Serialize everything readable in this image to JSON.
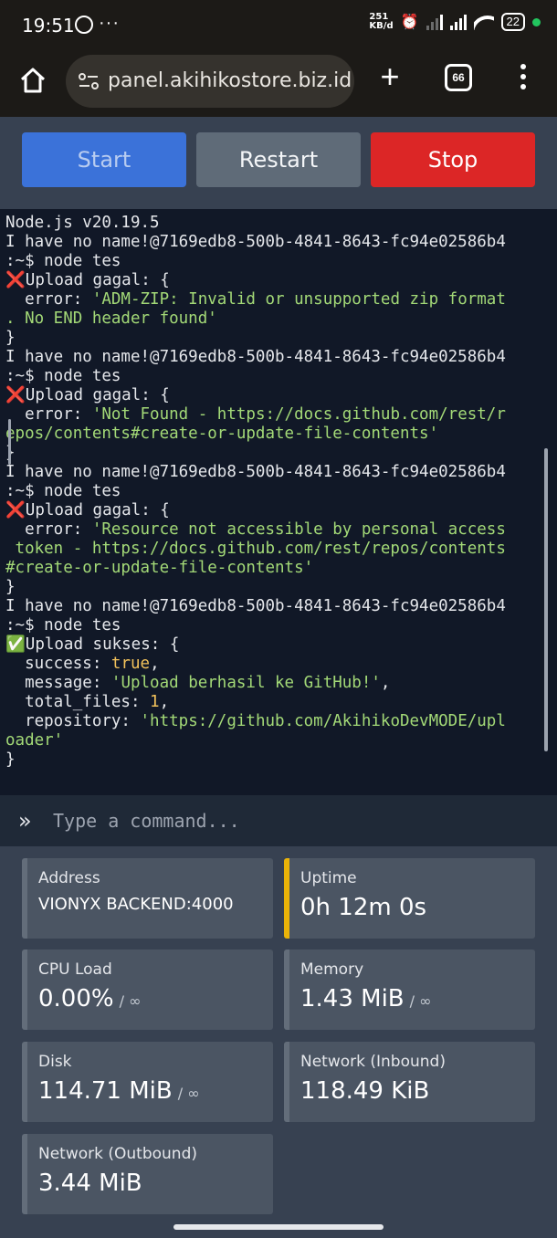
{
  "status_bar": {
    "time": "19:51",
    "more": "···",
    "net_speed_top": "251",
    "net_speed_bottom": "KB/d",
    "battery": "22"
  },
  "browser": {
    "url": "panel.akihikostore.biz.id",
    "tab_count": "66"
  },
  "actions": {
    "start_label": "Start",
    "restart_label": "Restart",
    "stop_label": "Stop"
  },
  "console": {
    "lines": [
      [
        {
          "t": "Node.js v20.19.5"
        }
      ],
      [
        {
          "t": "I have no name!@7169edb8-500b-4841-8643-fc94e02586b4"
        }
      ],
      [
        {
          "t": ":~$ node tes"
        }
      ],
      [
        {
          "t": "❌Upload gagal: {"
        }
      ],
      [
        {
          "t": "  error: "
        },
        {
          "t": "'ADM-ZIP: Invalid or unsupported zip format",
          "c": "str"
        }
      ],
      [
        {
          "t": ". No END header found'",
          "c": "str"
        }
      ],
      [
        {
          "t": "}"
        }
      ],
      [
        {
          "t": "I have no name!@7169edb8-500b-4841-8643-fc94e02586b4"
        }
      ],
      [
        {
          "t": ":~$ node tes"
        }
      ],
      [
        {
          "t": "❌Upload gagal: {"
        }
      ],
      [
        {
          "t": "  error: "
        },
        {
          "t": "'Not Found - https://docs.github.com/rest/r",
          "c": "str"
        }
      ],
      [
        {
          "t": "epos/contents#create-or-update-file-contents'",
          "c": "str"
        }
      ],
      [
        {
          "t": "}"
        }
      ],
      [
        {
          "t": "I have no name!@7169edb8-500b-4841-8643-fc94e02586b4"
        }
      ],
      [
        {
          "t": ":~$ node tes"
        }
      ],
      [
        {
          "t": "❌Upload gagal: {"
        }
      ],
      [
        {
          "t": "  error: "
        },
        {
          "t": "'Resource not accessible by personal access",
          "c": "str"
        }
      ],
      [
        {
          "t": " token - https://docs.github.com/rest/repos/contents",
          "c": "str"
        }
      ],
      [
        {
          "t": "#create-or-update-file-contents'",
          "c": "str"
        }
      ],
      [
        {
          "t": "}"
        }
      ],
      [
        {
          "t": "I have no name!@7169edb8-500b-4841-8643-fc94e02586b4"
        }
      ],
      [
        {
          "t": ":~$ node tes"
        }
      ],
      [
        {
          "t": "✅Upload sukses: {"
        }
      ],
      [
        {
          "t": "  success: "
        },
        {
          "t": "true",
          "c": "kw"
        },
        {
          "t": ","
        }
      ],
      [
        {
          "t": "  message: "
        },
        {
          "t": "'Upload berhasil ke GitHub!'",
          "c": "str"
        },
        {
          "t": ","
        }
      ],
      [
        {
          "t": "  total_files: "
        },
        {
          "t": "1",
          "c": "kw"
        },
        {
          "t": ","
        }
      ],
      [
        {
          "t": "  repository: "
        },
        {
          "t": "'https://github.com/AkihikoDevMODE/upl",
          "c": "str"
        }
      ],
      [
        {
          "t": "oader'",
          "c": "str"
        }
      ],
      [
        {
          "t": "}"
        }
      ]
    ]
  },
  "command": {
    "placeholder": "Type a command..."
  },
  "stats": {
    "address": {
      "label": "Address",
      "value": "VIONYX BACKEND:4000"
    },
    "uptime": {
      "label": "Uptime",
      "value": "0h 12m 0s"
    },
    "cpu": {
      "label": "CPU Load",
      "value": "0.00%",
      "limit": "/ ∞"
    },
    "memory": {
      "label": "Memory",
      "value": "1.43 MiB",
      "limit": "/ ∞"
    },
    "disk": {
      "label": "Disk",
      "value": "114.71 MiB",
      "limit": "/ ∞"
    },
    "net_in": {
      "label": "Network (Inbound)",
      "value": "118.49 KiB"
    },
    "net_out": {
      "label": "Network (Outbound)",
      "value": "3.44 MiB"
    }
  },
  "colors": {
    "start": "#3b72d9",
    "restart": "#5f6b78",
    "stop": "#dc2626",
    "uptime_accent": "#eab308",
    "console_bg": "#111827"
  }
}
